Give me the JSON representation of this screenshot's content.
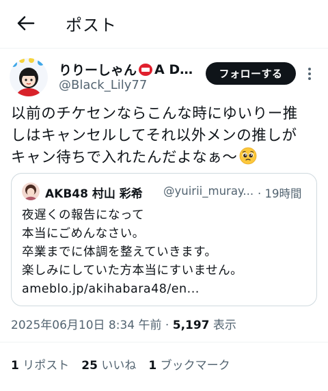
{
  "header": {
    "title": "ポスト"
  },
  "author": {
    "display_name": "りりーしゃん",
    "display_suffix": "A D…",
    "handle": "@Black_Lily77",
    "follow_label": "フォローする"
  },
  "post": {
    "lines": [
      "以前のチケセンならこんな時にゆいりー推",
      "しはキャンセルしてそれ以外メンの推しが",
      "キャン待ちで入れたんだよなぁ〜"
    ]
  },
  "quote": {
    "name": "AKB48 村山 彩希",
    "handle": "@yuirii_muray...",
    "time": "· 19時間",
    "lines": [
      "夜遅くの報告になって",
      "本当にごめんなさい。",
      "卒業までに体調を整えていきます。",
      "楽しみにしていた方本当にすいません。",
      "ameblo.jp/akihabara48/en..."
    ]
  },
  "meta": {
    "timestamp": "2025年06月10日 8:34 午前 · ",
    "views_count": "5,197",
    "views_label": " 表示"
  },
  "stats": {
    "reposts_count": "1",
    "reposts_label": "リポスト",
    "likes_count": "25",
    "likes_label": "いいね",
    "bookmarks_count": "1",
    "bookmarks_label": "ブックマーク"
  },
  "icons": [
    "back-arrow-icon",
    "badge-icon",
    "more-icon",
    "pleading-face-emoji"
  ],
  "colors": {
    "text": "#0f1419",
    "secondary": "#536471",
    "border": "#cfd9de",
    "follow_bg": "#0f1419"
  }
}
